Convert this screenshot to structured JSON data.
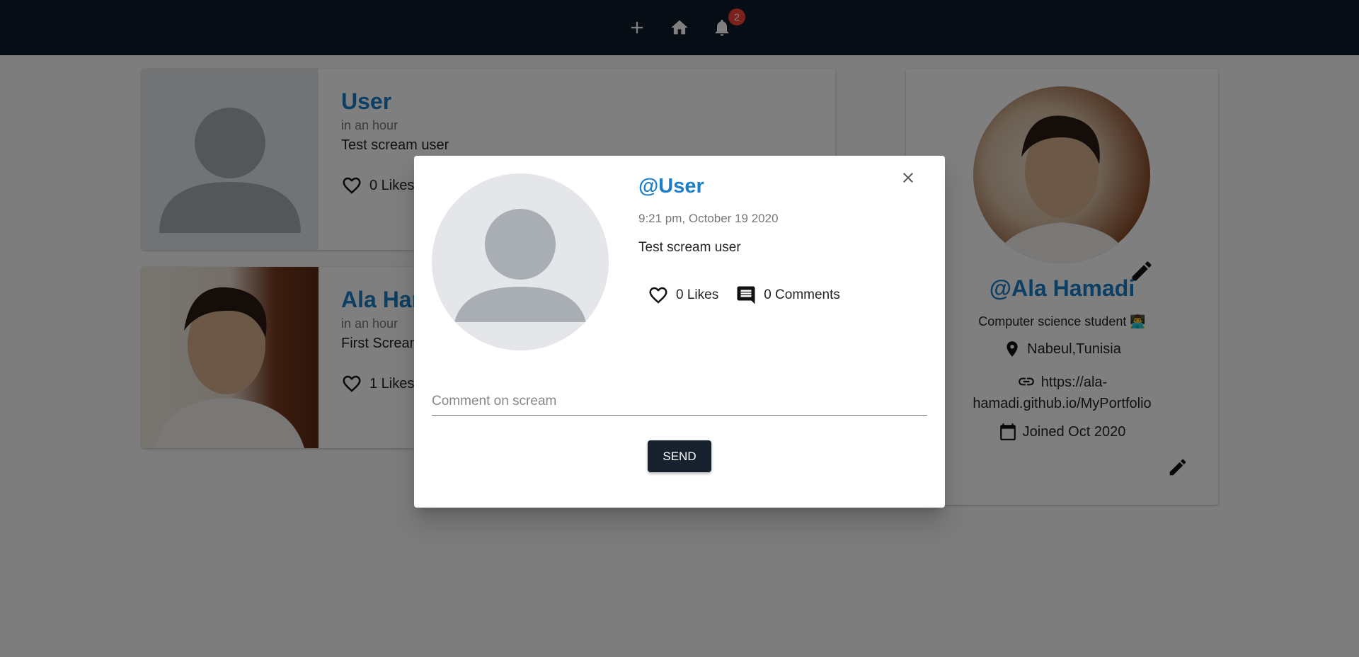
{
  "nav": {
    "add_icon": "plus-icon",
    "home_icon": "home-icon",
    "notifications_icon": "bell-icon",
    "notification_count": "2"
  },
  "screams": [
    {
      "user": "User",
      "time": "in an hour",
      "body": "Test scream user",
      "likes": "0 Likes"
    },
    {
      "user": "Ala Hamadi",
      "time": "in an hour",
      "body": "First Scream",
      "likes": "1 Likes"
    }
  ],
  "profile": {
    "handle": "@Ala Hamadi",
    "bio": "Computer science student 👨‍💻",
    "location": "Nabeul,Tunisia",
    "website": "https://ala-hamadi.github.io/MyPortfolio",
    "joined": "Joined Oct 2020"
  },
  "dialog": {
    "handle": "@User",
    "time": "9:21 pm, October 19 2020",
    "body": "Test scream user",
    "likes": "0 Likes",
    "comments": "0 Comments",
    "comment_placeholder": "Comment on scream",
    "send_label": "SEND"
  },
  "colors": {
    "navbar": "#0f1a2a",
    "accent": "#1a7fc8",
    "badge": "#f44336",
    "button": "#17212e"
  }
}
